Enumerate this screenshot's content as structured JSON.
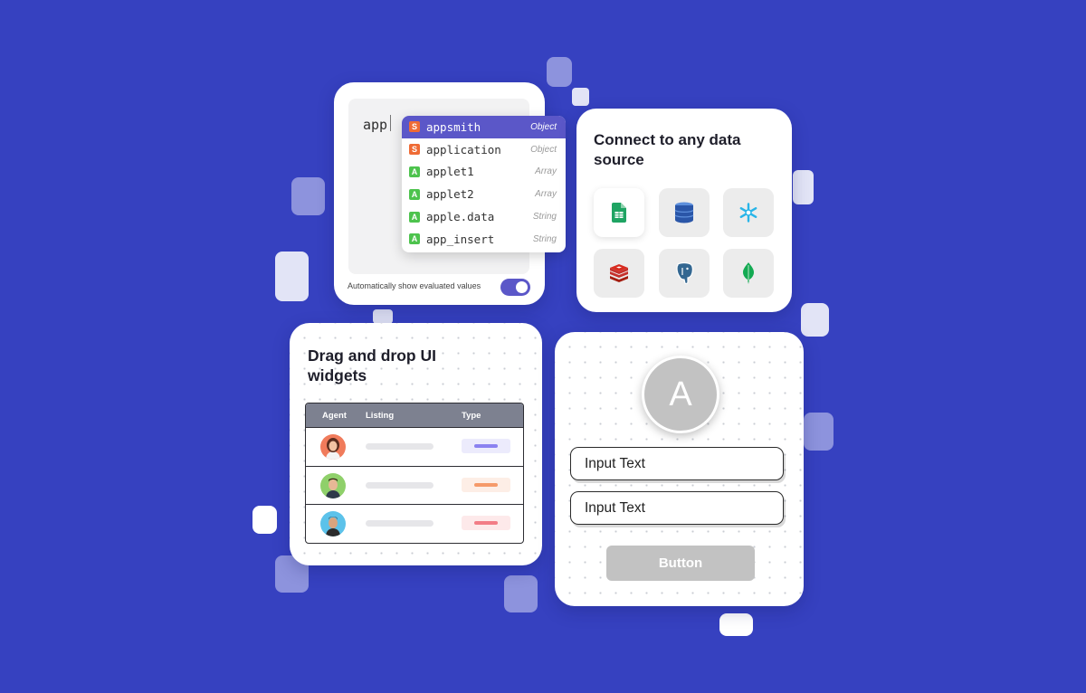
{
  "editor": {
    "typed_text": "app",
    "suggestions": [
      {
        "badge": "S",
        "label": "appsmith",
        "type": "Object",
        "active": true
      },
      {
        "badge": "S",
        "label": "application",
        "type": "Object",
        "active": false
      },
      {
        "badge": "A",
        "label": "applet1",
        "type": "Array",
        "active": false
      },
      {
        "badge": "A",
        "label": "applet2",
        "type": "Array",
        "active": false
      },
      {
        "badge": "A",
        "label": "apple.data",
        "type": "String",
        "active": false
      },
      {
        "badge": "A",
        "label": "app_insert",
        "type": "String",
        "active": false
      }
    ],
    "toggle_label": "Automatically show evaluated values",
    "toggle_on": true
  },
  "data_sources": {
    "title": "Connect to any data source",
    "icons": [
      "google-sheets-icon",
      "dynamodb-icon",
      "snowflake-icon",
      "redis-icon",
      "postgresql-icon",
      "mongodb-icon"
    ]
  },
  "widgets": {
    "title": "Drag and drop UI widgets",
    "table": {
      "headers": [
        "Agent",
        "Listing",
        "Type"
      ],
      "rows": [
        {
          "avatar": "agent-avatar-1",
          "type_color": "#8b82f0"
        },
        {
          "avatar": "agent-avatar-2",
          "type_color": "#f59a6a"
        },
        {
          "avatar": "agent-avatar-3",
          "type_color": "#f27c86"
        }
      ]
    }
  },
  "form": {
    "avatar_letter": "A",
    "input1": "Input Text",
    "input2": "Input Text",
    "button": "Button"
  },
  "colors": {
    "background": "#3641c0",
    "accent": "#5b57c8"
  }
}
